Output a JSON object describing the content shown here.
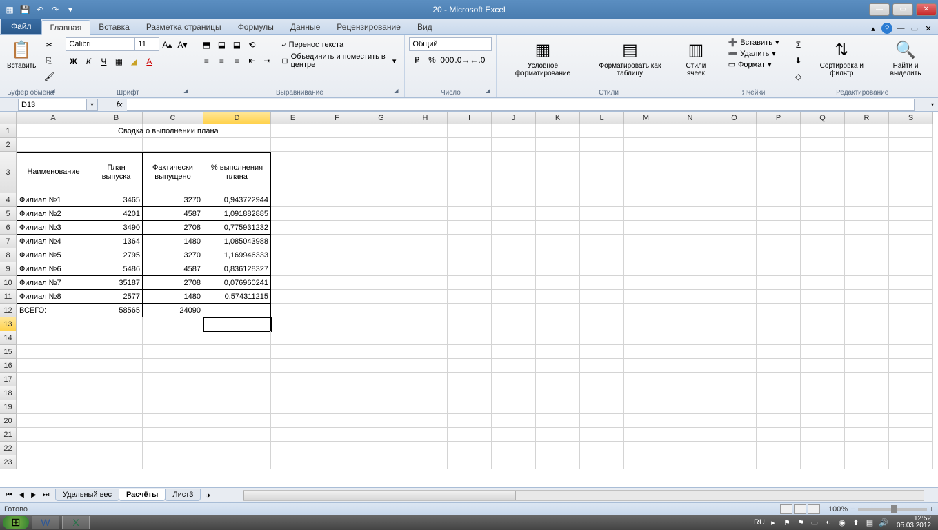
{
  "window": {
    "title": "20 - Microsoft Excel",
    "min": "—",
    "max": "▭",
    "close": "✕"
  },
  "qat": {
    "save": "💾",
    "undo": "↶",
    "redo": "↷"
  },
  "tabs": {
    "file": "Файл",
    "items": [
      "Главная",
      "Вставка",
      "Разметка страницы",
      "Формулы",
      "Данные",
      "Рецензирование",
      "Вид"
    ],
    "active": 0
  },
  "help": {
    "up": "▴",
    "q": "?",
    "min2": "—",
    "max2": "▭",
    "close2": "✕"
  },
  "ribbon": {
    "clipboard": {
      "paste": "Вставить",
      "label": "Буфер обмена"
    },
    "font": {
      "name": "Calibri",
      "size": "11",
      "label": "Шрифт"
    },
    "align": {
      "wrap": "Перенос текста",
      "merge": "Объединить и поместить в центре",
      "label": "Выравнивание"
    },
    "number": {
      "format": "Общий",
      "label": "Число"
    },
    "styles": {
      "cond": "Условное форматирование",
      "table": "Форматировать как таблицу",
      "cell": "Стили ячеек",
      "label": "Стили"
    },
    "cells": {
      "insert": "Вставить",
      "delete": "Удалить",
      "format": "Формат",
      "label": "Ячейки"
    },
    "editing": {
      "sort": "Сортировка и фильтр",
      "find": "Найти и выделить",
      "label": "Редактирование"
    }
  },
  "namebox": "D13",
  "formula": "",
  "columns": [
    "A",
    "B",
    "C",
    "D",
    "E",
    "F",
    "G",
    "H",
    "I",
    "J",
    "K",
    "L",
    "M",
    "N",
    "O",
    "P",
    "Q",
    "R",
    "S"
  ],
  "selectedCol": "D",
  "selectedRow": 13,
  "sheet": {
    "title": "Сводка о выполнении плана",
    "headers": {
      "a": "Наименование",
      "b": "План выпуска",
      "c": "Фактически выпущено",
      "d": "% выполнения плана"
    },
    "rows": [
      {
        "a": "Филиал №1",
        "b": "3465",
        "c": "3270",
        "d": "0,943722944"
      },
      {
        "a": "Филиал №2",
        "b": "4201",
        "c": "4587",
        "d": "1,091882885"
      },
      {
        "a": "Филиал №3",
        "b": "3490",
        "c": "2708",
        "d": "0,775931232"
      },
      {
        "a": "Филиал №4",
        "b": "1364",
        "c": "1480",
        "d": "1,085043988"
      },
      {
        "a": "Филиал №5",
        "b": "2795",
        "c": "3270",
        "d": "1,169946333"
      },
      {
        "a": "Филиал №6",
        "b": "5486",
        "c": "4587",
        "d": "0,836128327"
      },
      {
        "a": "Филиал №7",
        "b": "35187",
        "c": "2708",
        "d": "0,076960241"
      },
      {
        "a": "Филиал №8",
        "b": "2577",
        "c": "1480",
        "d": "0,574311215"
      }
    ],
    "total": {
      "a": "ВСЕГО:",
      "b": "58565",
      "c": "24090",
      "d": ""
    }
  },
  "sheets": {
    "nav": [
      "⏮",
      "◀",
      "▶",
      "⏭"
    ],
    "tabs": [
      "Удельный вес",
      "Расчёты",
      "Лист3"
    ],
    "active": 1
  },
  "status": {
    "ready": "Готово",
    "zoom": "100%"
  },
  "taskbar": {
    "lang": "RU",
    "time": "12:52",
    "date": "05.03.2012"
  }
}
